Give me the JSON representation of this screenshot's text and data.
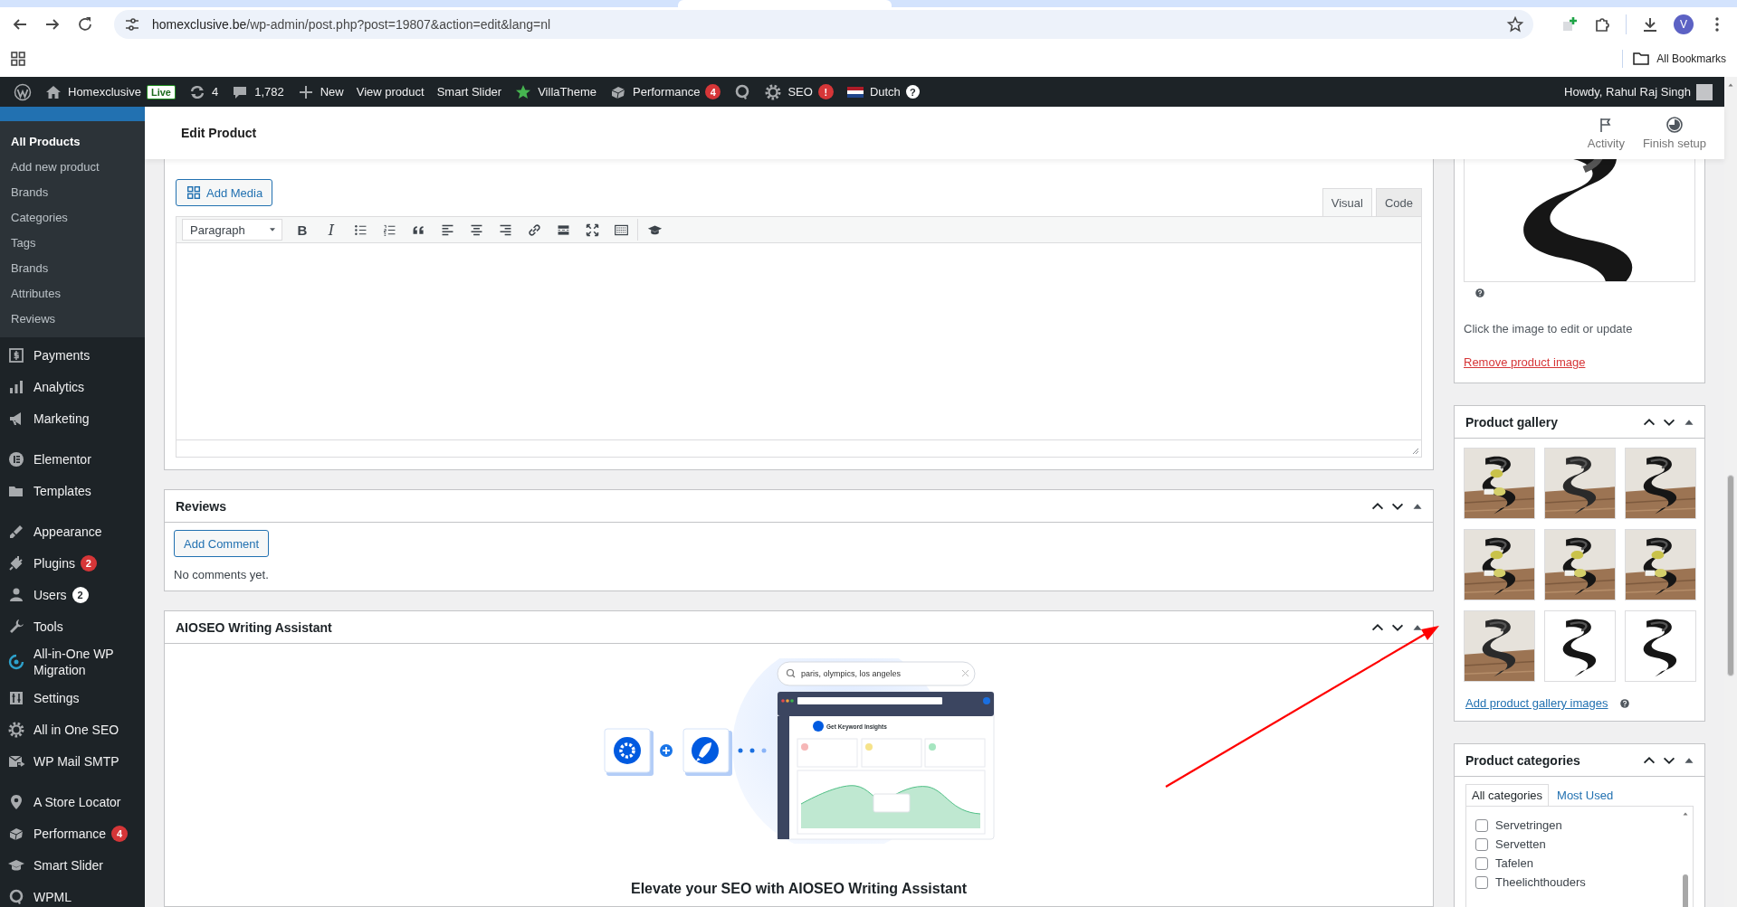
{
  "browser": {
    "url_host": "homexclusive.be",
    "url_path": "/wp-admin/post.php?post=19807&action=edit&lang=nl",
    "avatar": "V",
    "bookmarks": "All Bookmarks"
  },
  "admin_bar": {
    "items": [
      {
        "kind": "logo"
      },
      {
        "kind": "site",
        "label": "Homexclusive",
        "badge": "Live"
      },
      {
        "kind": "updates",
        "label": "4"
      },
      {
        "kind": "comments",
        "label": "1,782"
      },
      {
        "kind": "new",
        "label": "New"
      },
      {
        "kind": "text",
        "label": "View product"
      },
      {
        "kind": "text",
        "label": "Smart Slider"
      },
      {
        "kind": "star",
        "label": "VillaTheme"
      },
      {
        "kind": "performance",
        "label": "Performance",
        "count": "4"
      },
      {
        "kind": "wpml"
      },
      {
        "kind": "seo",
        "label": "SEO",
        "count": "!"
      },
      {
        "kind": "language",
        "label": "Dutch",
        "help": "?"
      }
    ],
    "greeting": "Howdy, Rahul Raj Singh"
  },
  "sidebar": {
    "submenu": [
      {
        "label": "All Products",
        "selected": true
      },
      {
        "label": "Add new product",
        "selected": false
      },
      {
        "label": "Brands",
        "selected": false
      },
      {
        "label": "Categories",
        "selected": false
      },
      {
        "label": "Tags",
        "selected": false
      },
      {
        "label": "Brands",
        "selected": false
      },
      {
        "label": "Attributes",
        "selected": false
      },
      {
        "label": "Reviews",
        "selected": false
      }
    ],
    "groups": [
      {
        "items": [
          {
            "kind": "payments",
            "label": "Payments"
          },
          {
            "kind": "analytics",
            "label": "Analytics"
          },
          {
            "kind": "marketing",
            "label": "Marketing"
          }
        ]
      },
      {
        "items": [
          {
            "kind": "elementor",
            "label": "Elementor"
          },
          {
            "kind": "templates",
            "label": "Templates"
          }
        ]
      },
      {
        "items": [
          {
            "kind": "appearance",
            "label": "Appearance"
          },
          {
            "kind": "plugins",
            "label": "Plugins",
            "count": "2",
            "color": "#d63638"
          },
          {
            "kind": "users",
            "label": "Users",
            "count": "2",
            "color": "#ffffff"
          },
          {
            "kind": "tools",
            "label": "Tools"
          },
          {
            "kind": "migration",
            "label": "All-in-One WP Migration"
          },
          {
            "kind": "settings",
            "label": "Settings"
          },
          {
            "kind": "seo",
            "label": "All in One SEO"
          },
          {
            "kind": "mail",
            "label": "WP Mail SMTP"
          }
        ]
      },
      {
        "items": [
          {
            "kind": "pin",
            "label": "A Store Locator"
          },
          {
            "kind": "performance",
            "label": "Performance",
            "count": "4",
            "color": "#d63638"
          },
          {
            "kind": "slider",
            "label": "Smart Slider"
          },
          {
            "kind": "wpml",
            "label": "WPML"
          }
        ]
      }
    ]
  },
  "header": {
    "title": "Edit Product",
    "actions": [
      {
        "kind": "flag",
        "label": "Activity"
      },
      {
        "kind": "progress",
        "label": "Finish setup"
      }
    ]
  },
  "short_description": {
    "add_media": "Add Media",
    "tabs": [
      {
        "label": "Visual",
        "selected": true
      },
      {
        "label": "Code",
        "selected": false
      }
    ],
    "format": "Paragraph",
    "tools": [
      {
        "kind": "bold",
        "label": "B"
      },
      {
        "kind": "italic",
        "label": "I"
      },
      {
        "kind": "bullets"
      },
      {
        "kind": "numbers"
      },
      {
        "kind": "quote"
      },
      {
        "kind": "align-left"
      },
      {
        "kind": "align-center"
      },
      {
        "kind": "align-right"
      },
      {
        "kind": "link"
      },
      {
        "kind": "more"
      },
      {
        "kind": "fullscreen"
      },
      {
        "kind": "kitchen"
      },
      {
        "kind": "separator"
      },
      {
        "kind": "mortarboard"
      }
    ]
  },
  "reviews": {
    "title": "Reviews",
    "button": "Add Comment",
    "empty": "No comments yet."
  },
  "writing_assistant": {
    "title": "AIOSEO Writing Assistant",
    "search_text": "paris, olympics, los angeles",
    "insight_title": "Get Keyword Insights",
    "heading": "Elevate your SEO with AIOSEO Writing Assistant"
  },
  "product_image": {
    "kind": "picture",
    "hint": "Click the image to edit or update",
    "remove_link": "Remove product image"
  },
  "gallery": {
    "title": "Product gallery",
    "add_link": "Add product gallery images"
  },
  "categories": {
    "title": "Product categories",
    "tabs": [
      {
        "label": "All categories",
        "selected": true
      },
      {
        "label": "Most Used",
        "selected": false
      }
    ],
    "items": [
      {
        "label": "Servetringen",
        "checked": false
      },
      {
        "label": "Servetten",
        "checked": false
      },
      {
        "label": "Tafelen",
        "checked": false
      },
      {
        "label": "Theelichthouders",
        "checked": false
      }
    ]
  }
}
